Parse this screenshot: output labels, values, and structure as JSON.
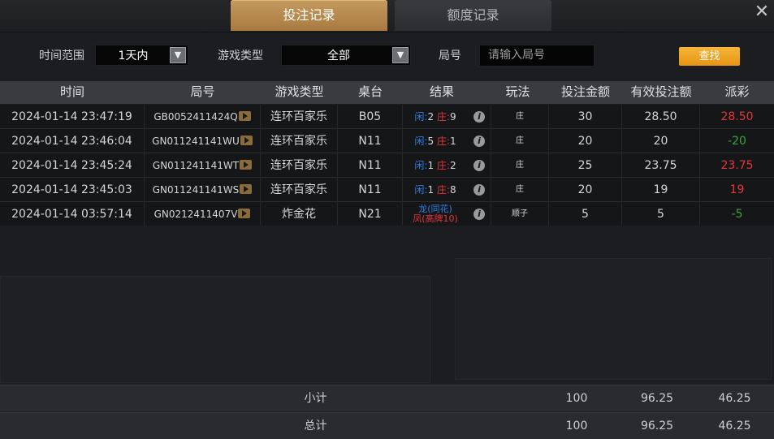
{
  "tabs": [
    {
      "label": "投注记录",
      "active": true
    },
    {
      "label": "额度记录",
      "active": false
    }
  ],
  "close_glyph": "✕",
  "filters": {
    "time_range_label": "时间范围",
    "time_range_value": "1天内",
    "game_type_label": "游戏类型",
    "game_type_value": "全部",
    "round_label": "局号",
    "round_placeholder": "请输入局号",
    "search_button": "查找"
  },
  "table": {
    "headers": [
      "时间",
      "局号",
      "游戏类型",
      "桌台",
      "结果",
      "玩法",
      "投注金额",
      "有效投注额",
      "派彩"
    ],
    "rows": [
      {
        "time": "2024-01-14 23:47:19",
        "round": "GB0052411424Q",
        "game": "连环百家乐",
        "table": "B05",
        "result_a_label": "闲:",
        "result_a_val": "2",
        "result_b_label": "庄:",
        "result_b_val": "9",
        "play": "庄",
        "bet": "30",
        "valid": "28.50",
        "payout": "28.50",
        "payout_color": "red"
      },
      {
        "time": "2024-01-14 23:46:04",
        "round": "GN011241141WU",
        "game": "连环百家乐",
        "table": "N11",
        "result_a_label": "闲:",
        "result_a_val": "5",
        "result_b_label": "庄:",
        "result_b_val": "1",
        "play": "庄",
        "bet": "20",
        "valid": "20",
        "payout": "-20",
        "payout_color": "green"
      },
      {
        "time": "2024-01-14 23:45:24",
        "round": "GN011241141WT",
        "game": "连环百家乐",
        "table": "N11",
        "result_a_label": "闲:",
        "result_a_val": "1",
        "result_b_label": "庄:",
        "result_b_val": "2",
        "play": "庄",
        "bet": "25",
        "valid": "23.75",
        "payout": "23.75",
        "payout_color": "red"
      },
      {
        "time": "2024-01-14 23:45:03",
        "round": "GN011241141WS",
        "game": "连环百家乐",
        "table": "N11",
        "result_a_label": "闲:",
        "result_a_val": "1",
        "result_b_label": "庄:",
        "result_b_val": "8",
        "play": "庄",
        "bet": "20",
        "valid": "19",
        "payout": "19",
        "payout_color": "red"
      },
      {
        "time": "2024-01-14 03:57:14",
        "round": "GN0212411407V",
        "game": "炸金花",
        "table": "N21",
        "result_line1": "龙(同花)",
        "result_line2": "凤(高牌10)",
        "play": "顺子",
        "bet": "5",
        "valid": "5",
        "payout": "-5",
        "payout_color": "green"
      }
    ]
  },
  "subtotal": {
    "label": "小计",
    "bet": "100",
    "valid": "96.25",
    "payout": "46.25"
  },
  "total": {
    "label": "总计",
    "bet": "100",
    "valid": "96.25",
    "payout": "46.25"
  },
  "colors": {
    "accent": "#c49a5e",
    "search": "#f0a520",
    "win": "#e5363a",
    "loss": "#3aa53a",
    "player": "#2f7fe6"
  }
}
